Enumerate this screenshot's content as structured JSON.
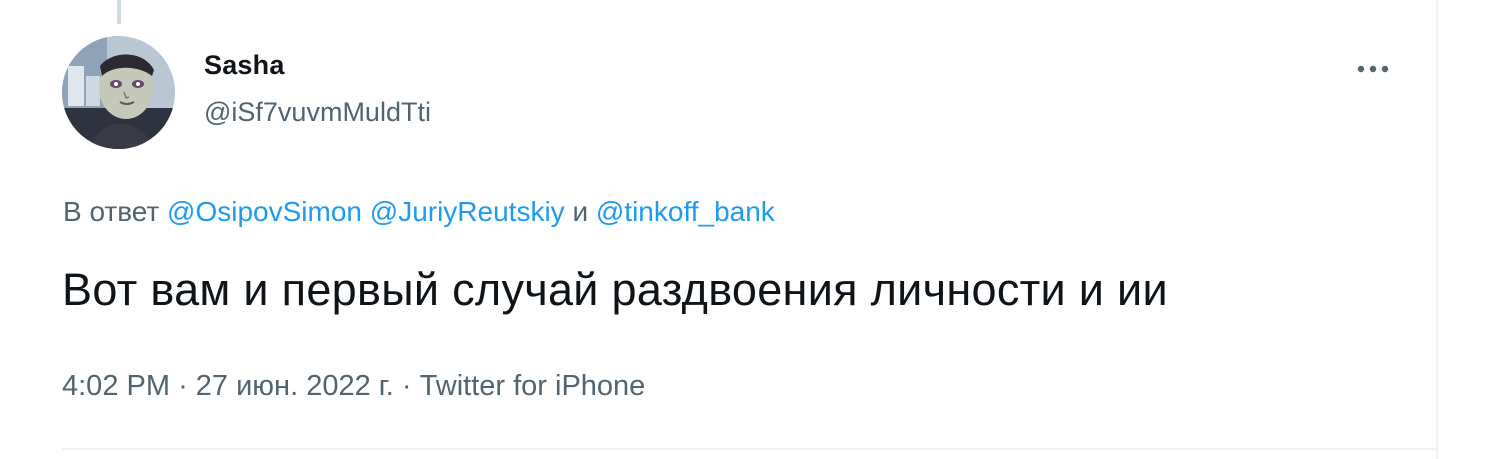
{
  "author": {
    "display_name": "Sasha",
    "handle": "@iSf7vuvmMuldTti"
  },
  "reply": {
    "prefix": "В ответ",
    "mentions": [
      "@OsipovSimon",
      "@JuriyReutskiy",
      "@tinkoff_bank"
    ],
    "conjunction": "и"
  },
  "tweet": {
    "text": "Вот вам и первый случай раздвоения личности и ии"
  },
  "meta": {
    "time": "4:02 PM",
    "separator": "·",
    "date": "27 июн. 2022 г.",
    "source": "Twitter for iPhone"
  },
  "icons": {
    "more": "more-horizontal-icon",
    "avatar": "user-avatar"
  },
  "colors": {
    "accent": "#1d9bf0",
    "text_primary": "#0f1419",
    "text_secondary": "#536471",
    "divider": "#eff3f4"
  }
}
